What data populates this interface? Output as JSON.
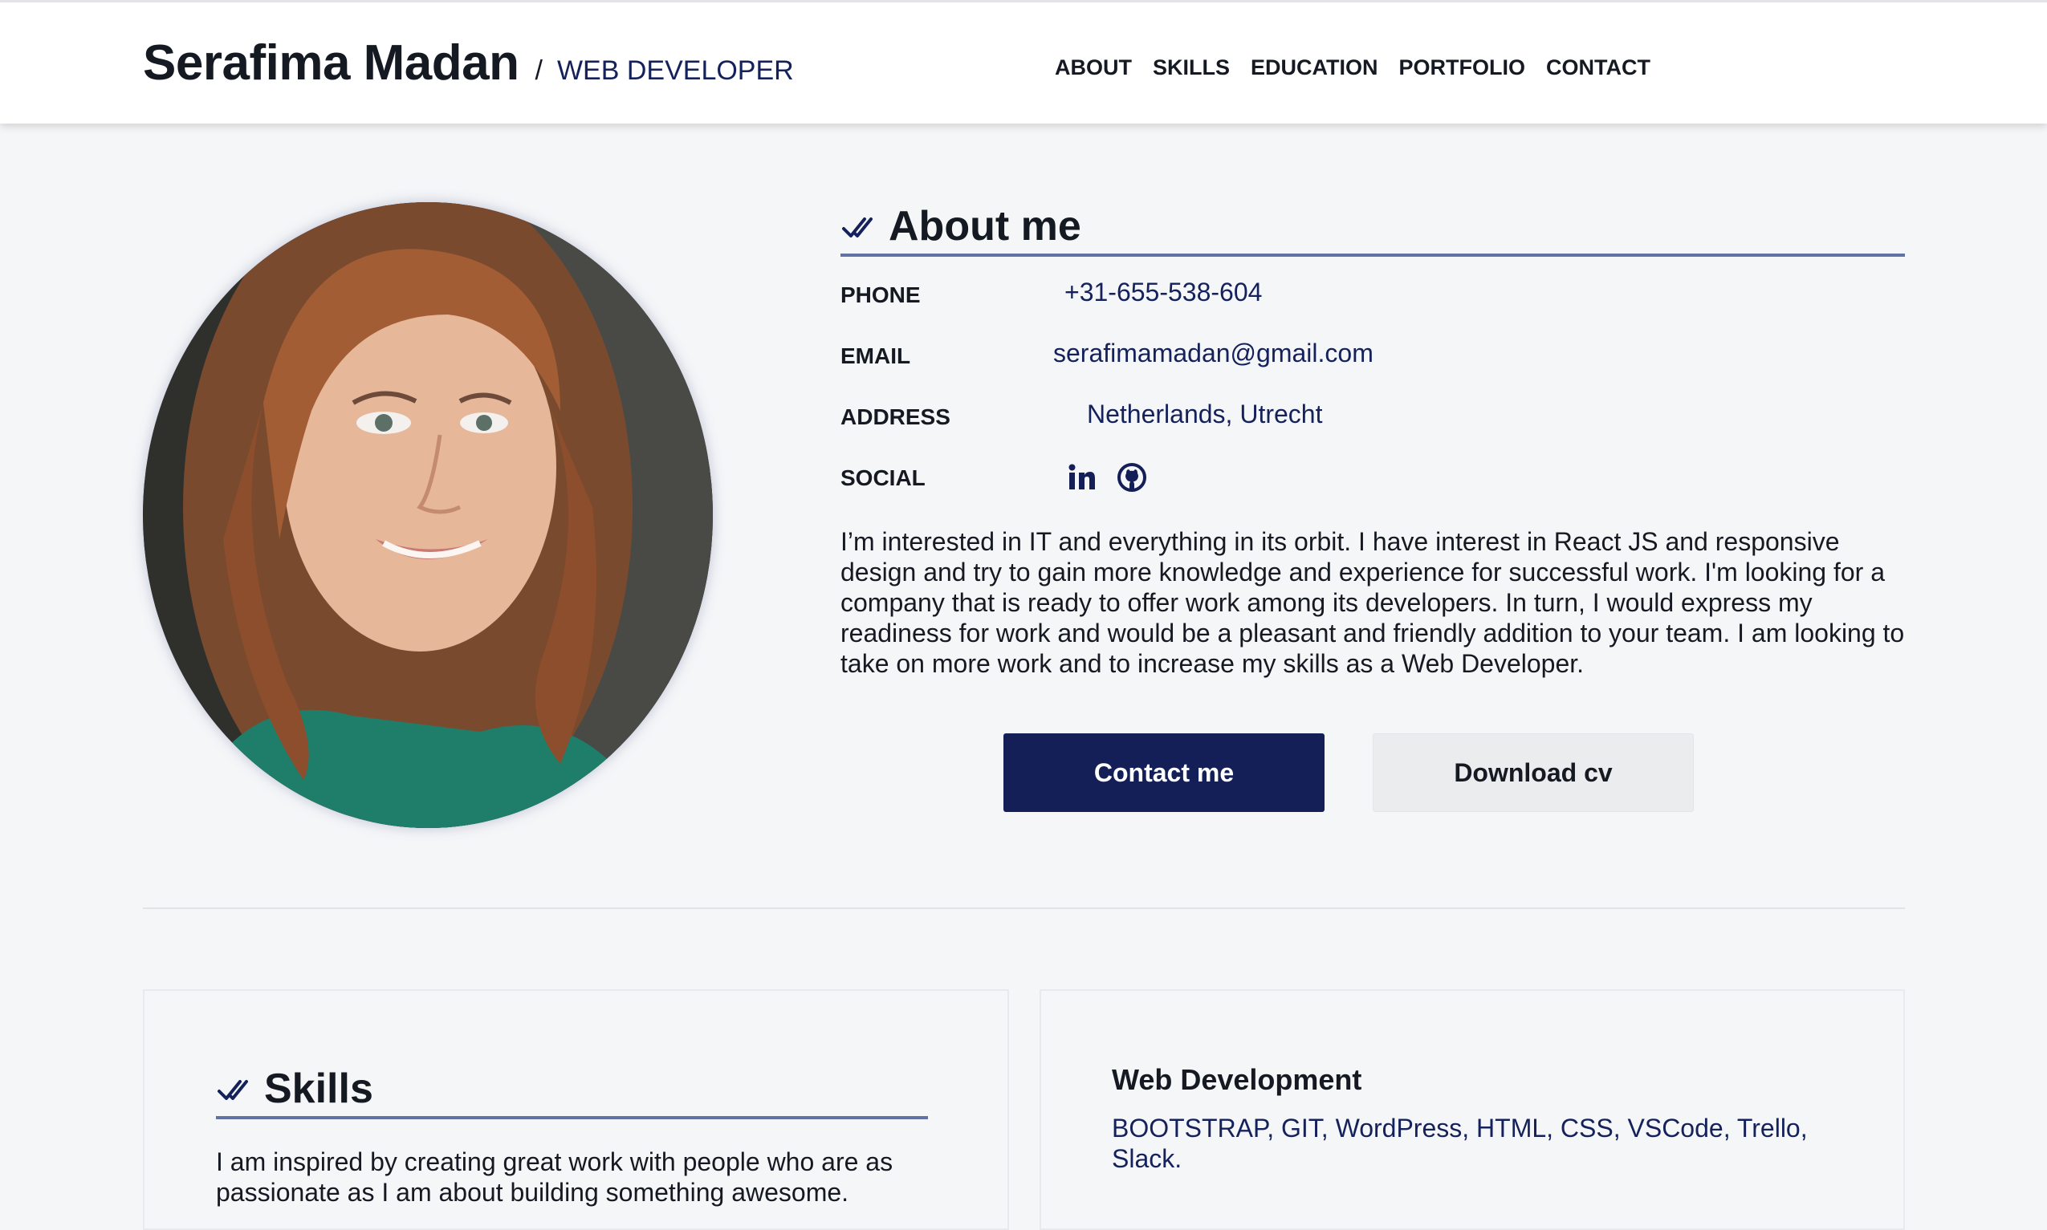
{
  "header": {
    "name": "Serafima Madan",
    "separator": "/",
    "role": "WEB DEVELOPER",
    "nav": [
      {
        "label": "ABOUT"
      },
      {
        "label": "SKILLS"
      },
      {
        "label": "EDUCATION"
      },
      {
        "label": "PORTFOLIO"
      },
      {
        "label": "CONTACT"
      }
    ]
  },
  "about": {
    "title": "About me",
    "phone_label": "PHONE",
    "phone": "+31-655-538-604",
    "email_label": "EMAIL",
    "email": "serafimamadan@gmail.com",
    "address_label": "ADDRESS",
    "address": "Netherlands, Utrecht",
    "social_label": "SOCIAL",
    "social_icons": [
      "linkedin-icon",
      "github-icon"
    ],
    "bio": "I’m interested in IT and everything in its orbit. I have interest in React JS and responsive design and try to gain more knowledge and experience for successful work. I'm looking for a company that is ready to offer work among its developers. In turn, I would express my readiness for work and would be a pleasant and friendly addition to your team. I am looking to take on more work and to increase my skills as a Web Developer.",
    "contact_button": "Contact me",
    "download_button": "Download cv"
  },
  "skills": {
    "title": "Skills",
    "text": "I am inspired by creating great work with people who are as passionate as I am about building something awesome."
  },
  "web_development": {
    "title": "Web Development",
    "list": "BOOTSTRAP, GIT, WordPress, HTML, CSS, VSCode, Trello, Slack."
  },
  "colors": {
    "accent": "#141f57",
    "link": "#15215a",
    "underline": "#6272a4",
    "background": "#f5f6f8"
  }
}
